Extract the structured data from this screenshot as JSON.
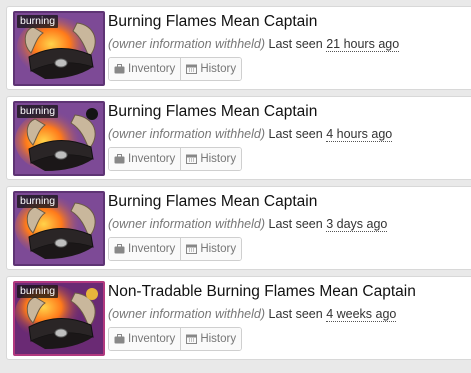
{
  "listings": [
    {
      "quality_tag": "burning",
      "paint_color": "",
      "title": "Burning Flames Mean Captain",
      "owner": "(owner information withheld)",
      "last_seen_prefix": "Last seen",
      "last_seen_ago": "21 hours ago",
      "inventory_label": "Inventory",
      "history_label": "History"
    },
    {
      "quality_tag": "burning",
      "paint_color": "#141414",
      "title": "Burning Flames Mean Captain",
      "owner": "(owner information withheld)",
      "last_seen_prefix": "Last seen",
      "last_seen_ago": "4 hours ago",
      "inventory_label": "Inventory",
      "history_label": "History"
    },
    {
      "quality_tag": "burning",
      "paint_color": "",
      "title": "Burning Flames Mean Captain",
      "owner": "(owner information withheld)",
      "last_seen_prefix": "Last seen",
      "last_seen_ago": "3 days ago",
      "inventory_label": "Inventory",
      "history_label": "History"
    },
    {
      "quality_tag": "burning",
      "paint_color": "#e7b53b",
      "title": "Non-Tradable Burning Flames Mean Captain",
      "owner": "(owner information withheld)",
      "last_seen_prefix": "Last seen",
      "last_seen_ago": "4 weeks ago",
      "inventory_label": "Inventory",
      "history_label": "History"
    }
  ],
  "icons": {
    "inventory": "briefcase-icon",
    "history": "calendar-icon",
    "item": "mean-captain-hat-icon"
  },
  "colors": {
    "unique_border": "#5e3474",
    "self_made_border": "#b2397f",
    "flames": "#ff7a1a"
  }
}
